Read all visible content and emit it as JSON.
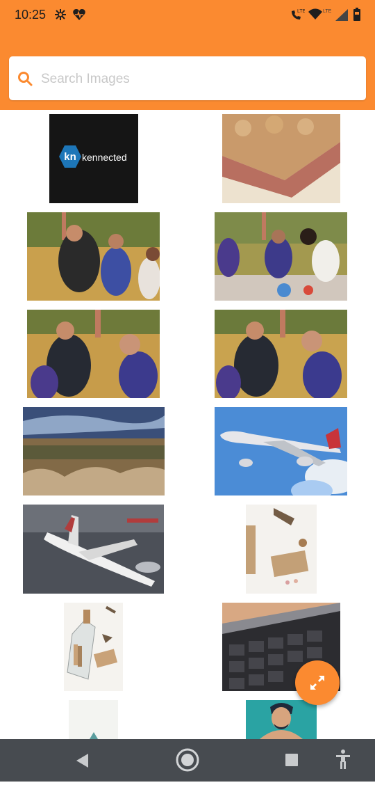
{
  "status": {
    "time": "10:25",
    "left_icons": [
      "pinwheel-icon",
      "heart-pulse-icon"
    ],
    "right_icons": [
      "volte-call-icon",
      "wifi-icon",
      "signal-icon",
      "battery-icon"
    ]
  },
  "search": {
    "placeholder": "Search Images",
    "value": ""
  },
  "images": [
    {
      "name": "kennected-logo",
      "text": "kennected",
      "logo_text": "kn",
      "bg": "#151515",
      "accent": "#1d76b8"
    },
    {
      "name": "sandwich-photo",
      "colors": [
        "#c99a6b",
        "#e8d2b0",
        "#b86f60"
      ]
    },
    {
      "name": "couple-park-photo",
      "colors": [
        "#6c7b3a",
        "#c9a04d",
        "#3d4fa3"
      ]
    },
    {
      "name": "picnic-group-photo",
      "colors": [
        "#7e8b4a",
        "#d1c7bd",
        "#4a3a8c"
      ]
    },
    {
      "name": "couple-feeding-photo",
      "colors": [
        "#6e7a3a",
        "#c79c4a",
        "#3c3a8d"
      ]
    },
    {
      "name": "couple-feeding-photo-2",
      "colors": [
        "#6b7a3b",
        "#c9a34f",
        "#3b3a8e"
      ]
    },
    {
      "name": "wetland-landscape-photo",
      "colors": [
        "#3a4f79",
        "#826a47",
        "#c2a986"
      ]
    },
    {
      "name": "airplane-flying-photo",
      "colors": [
        "#4b8cd6",
        "#a9cbf2",
        "#e8eef4"
      ]
    },
    {
      "name": "toy-airplanes-photo",
      "colors": [
        "#4c5058",
        "#d8d8d8",
        "#b13c3c"
      ]
    },
    {
      "name": "bottle-notes-photo",
      "colors": [
        "#f4f2ee",
        "#c3a077",
        "#735c45"
      ]
    },
    {
      "name": "message-bottle-photo",
      "colors": [
        "#f5f3ef",
        "#c9a278",
        "#6f5a44"
      ]
    },
    {
      "name": "laptop-keyboard-photo",
      "colors": [
        "#2c2c30",
        "#d8a883",
        "#8a8a90"
      ]
    },
    {
      "name": "minimal-cone-photo",
      "colors": [
        "#f3f4f1",
        "#5a9d9e"
      ]
    },
    {
      "name": "man-illustration-photo",
      "colors": [
        "#2aa3a3",
        "#1f2a3a",
        "#d7a47e"
      ]
    }
  ],
  "fab": {
    "icon": "expand-arrows-icon"
  },
  "navbar": {
    "buttons": [
      "back-icon",
      "home-icon",
      "recents-icon",
      "accessibility-icon"
    ]
  },
  "colors": {
    "accent": "#fb8a30",
    "navbar": "#474b50"
  }
}
